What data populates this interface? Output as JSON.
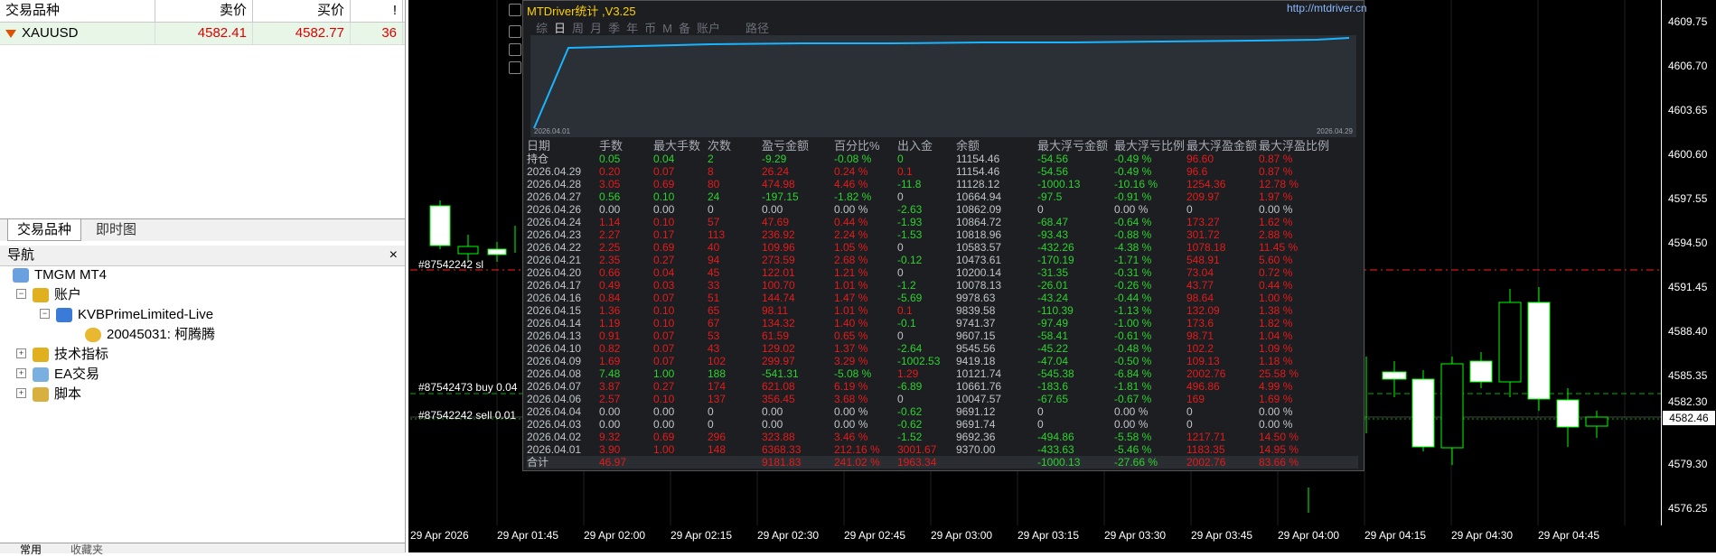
{
  "market_watch": {
    "headers": {
      "symbol": "交易品种",
      "bid": "卖价",
      "ask": "买价",
      "spread": "!"
    },
    "row": {
      "symbol": "XAUUSD",
      "bid": "4582.41",
      "ask": "4582.77",
      "spread": "36"
    },
    "tabs": [
      "交易品种",
      "即时图"
    ]
  },
  "navigator": {
    "title": "导航",
    "close": "×",
    "items": [
      {
        "label": "TMGM MT4"
      },
      {
        "label": "账户"
      },
      {
        "label": "KVBPrimeLimited-Live"
      },
      {
        "label": "20045031: 柯腾腾"
      },
      {
        "label": "技术指标"
      },
      {
        "label": "EA交易"
      },
      {
        "label": "脚本"
      }
    ],
    "bottom_tabs": [
      "常用",
      "收藏夹"
    ]
  },
  "chart": {
    "price_ticks": [
      "4609.75",
      "4606.70",
      "4603.65",
      "4600.60",
      "4597.55",
      "4594.50",
      "4591.45",
      "4588.40",
      "4585.35",
      "4582.30",
      "4579.30",
      "4576.25"
    ],
    "current_price": "4582.46",
    "time_ticks": [
      "29 Apr 2026",
      "29 Apr 01:45",
      "29 Apr 02:00",
      "29 Apr 02:15",
      "29 Apr 02:30",
      "29 Apr 02:45",
      "29 Apr 03:00",
      "29 Apr 03:15",
      "29 Apr 03:30",
      "29 Apr 03:45",
      "29 Apr 04:00",
      "29 Apr 04:15",
      "29 Apr 04:30",
      "29 Apr 04:45"
    ],
    "order_labels": [
      "#87542242 sl",
      "#87542473 buy 0.04",
      "#87542242 sell 0.01"
    ],
    "colors": {
      "background": "#000000",
      "candle_up": "#ffffff",
      "candle_body": "#00ff00",
      "sl_line": "#ff0000",
      "buy_line": "#00c000"
    }
  },
  "mtdriver": {
    "title": "MTDriver统计 ,V3.25",
    "url": "http://mtdriver.cn",
    "tabs": [
      "综",
      "日",
      "周",
      "月",
      "季",
      "年",
      "币",
      "M",
      "备",
      "账户",
      "",
      "",
      "",
      "路径"
    ],
    "graph": {
      "start": "2026.04.01",
      "end": "2026.04.29"
    },
    "headers": [
      "日期",
      "手数",
      "最大手数",
      "次数",
      "盈亏金额",
      "百分比%",
      "出入金",
      "余额",
      "最大浮亏金额",
      "最大浮亏比例",
      "最大浮盈金额",
      "最大浮盈比例"
    ],
    "holding": {
      "label": "持仓",
      "cells": [
        "0.05",
        "0.04",
        "2",
        "-9.29",
        "-0.08 %",
        "0",
        "11154.46",
        "-54.56",
        "-0.49 %",
        "96.60",
        "0.87 %"
      ]
    },
    "rows": [
      [
        "2026.04.29",
        "0.20",
        "0.07",
        "8",
        "26.24",
        "0.24 %",
        "0.1",
        "11154.46",
        "-54.56",
        "-0.49 %",
        "96.6",
        "0.87 %"
      ],
      [
        "2026.04.28",
        "3.05",
        "0.69",
        "80",
        "474.98",
        "4.46 %",
        "-11.8",
        "11128.12",
        "-1000.13",
        "-10.16 %",
        "1254.36",
        "12.78 %"
      ],
      [
        "2026.04.27",
        "0.56",
        "0.10",
        "24",
        "-197.15",
        "-1.82 %",
        "0",
        "10664.94",
        "-97.5",
        "-0.91 %",
        "209.97",
        "1.97 %"
      ],
      [
        "2026.04.26",
        "0.00",
        "0.00",
        "0",
        "0.00",
        "0.00 %",
        "-2.63",
        "10862.09",
        "0",
        "0.00 %",
        "0",
        "0.00 %"
      ],
      [
        "2026.04.24",
        "1.14",
        "0.10",
        "57",
        "47.69",
        "0.44 %",
        "-1.93",
        "10864.72",
        "-68.47",
        "-0.64 %",
        "173.27",
        "1.62 %"
      ],
      [
        "2026.04.23",
        "2.27",
        "0.17",
        "113",
        "236.92",
        "2.24 %",
        "-1.53",
        "10818.96",
        "-93.43",
        "-0.88 %",
        "301.72",
        "2.88 %"
      ],
      [
        "2026.04.22",
        "2.25",
        "0.69",
        "40",
        "109.96",
        "1.05 %",
        "0",
        "10583.57",
        "-432.26",
        "-4.38 %",
        "1078.18",
        "11.45 %"
      ],
      [
        "2026.04.21",
        "2.35",
        "0.27",
        "94",
        "273.59",
        "2.68 %",
        "-0.12",
        "10473.61",
        "-170.19",
        "-1.71 %",
        "548.91",
        "5.60 %"
      ],
      [
        "2026.04.20",
        "0.66",
        "0.04",
        "45",
        "122.01",
        "1.21 %",
        "0",
        "10200.14",
        "-31.35",
        "-0.31 %",
        "73.04",
        "0.72 %"
      ],
      [
        "2026.04.17",
        "0.49",
        "0.03",
        "33",
        "100.70",
        "1.01 %",
        "-1.2",
        "10078.13",
        "-26.01",
        "-0.26 %",
        "43.77",
        "0.44 %"
      ],
      [
        "2026.04.16",
        "0.84",
        "0.07",
        "51",
        "144.74",
        "1.47 %",
        "-5.69",
        "9978.63",
        "-43.24",
        "-0.44 %",
        "98.64",
        "1.00 %"
      ],
      [
        "2026.04.15",
        "1.36",
        "0.10",
        "65",
        "98.11",
        "1.01 %",
        "0.1",
        "9839.58",
        "-110.39",
        "-1.13 %",
        "132.09",
        "1.38 %"
      ],
      [
        "2026.04.14",
        "1.19",
        "0.10",
        "67",
        "134.32",
        "1.40 %",
        "-0.1",
        "9741.37",
        "-97.49",
        "-1.00 %",
        "173.6",
        "1.82 %"
      ],
      [
        "2026.04.13",
        "0.91",
        "0.07",
        "53",
        "61.59",
        "0.65 %",
        "0",
        "9607.15",
        "-58.41",
        "-0.61 %",
        "98.71",
        "1.04 %"
      ],
      [
        "2026.04.10",
        "0.82",
        "0.07",
        "43",
        "129.02",
        "1.37 %",
        "-2.64",
        "9545.56",
        "-45.22",
        "-0.48 %",
        "102.2",
        "1.09 %"
      ],
      [
        "2026.04.09",
        "1.69",
        "0.07",
        "102",
        "299.97",
        "3.29 %",
        "-1002.53",
        "9419.18",
        "-47.04",
        "-0.50 %",
        "109.13",
        "1.18 %"
      ],
      [
        "2026.04.08",
        "7.48",
        "1.00",
        "188",
        "-541.31",
        "-5.08 %",
        "1.29",
        "10121.74",
        "-545.38",
        "-6.84 %",
        "2002.76",
        "25.58 %"
      ],
      [
        "2026.04.07",
        "3.87",
        "0.27",
        "174",
        "621.08",
        "6.19 %",
        "-6.89",
        "10661.76",
        "-183.6",
        "-1.81 %",
        "496.86",
        "4.99 %"
      ],
      [
        "2026.04.06",
        "2.57",
        "0.10",
        "137",
        "356.45",
        "3.68 %",
        "0",
        "10047.57",
        "-67.65",
        "-0.67 %",
        "169",
        "1.69 %"
      ],
      [
        "2026.04.04",
        "0.00",
        "0.00",
        "0",
        "0.00",
        "0.00 %",
        "-0.62",
        "9691.12",
        "0",
        "0.00 %",
        "0",
        "0.00 %"
      ],
      [
        "2026.04.03",
        "0.00",
        "0.00",
        "0",
        "0.00",
        "0.00 %",
        "-0.62",
        "9691.74",
        "0",
        "0.00 %",
        "0",
        "0.00 %"
      ],
      [
        "2026.04.02",
        "9.32",
        "0.69",
        "296",
        "323.88",
        "3.46 %",
        "-1.52",
        "9692.36",
        "-494.86",
        "-5.58 %",
        "1217.71",
        "14.50 %"
      ],
      [
        "2026.04.01",
        "3.90",
        "1.00",
        "148",
        "6368.33",
        "212.16 %",
        "3001.67",
        "9370.00",
        "-433.63",
        "-5.46 %",
        "1183.35",
        "14.95 %"
      ]
    ],
    "total": {
      "label": "合计",
      "cells": [
        "46.97",
        "",
        "",
        "9181.83",
        "241.02 %",
        "1963.34",
        "",
        "-1000.13",
        "-27.66 %",
        "2002.76",
        "83.66 %"
      ]
    },
    "colors": {
      "positive": "#2fd12f",
      "negative": "#e21c1c",
      "neutral": "#c0c4c8",
      "title": "#ffd000"
    }
  }
}
